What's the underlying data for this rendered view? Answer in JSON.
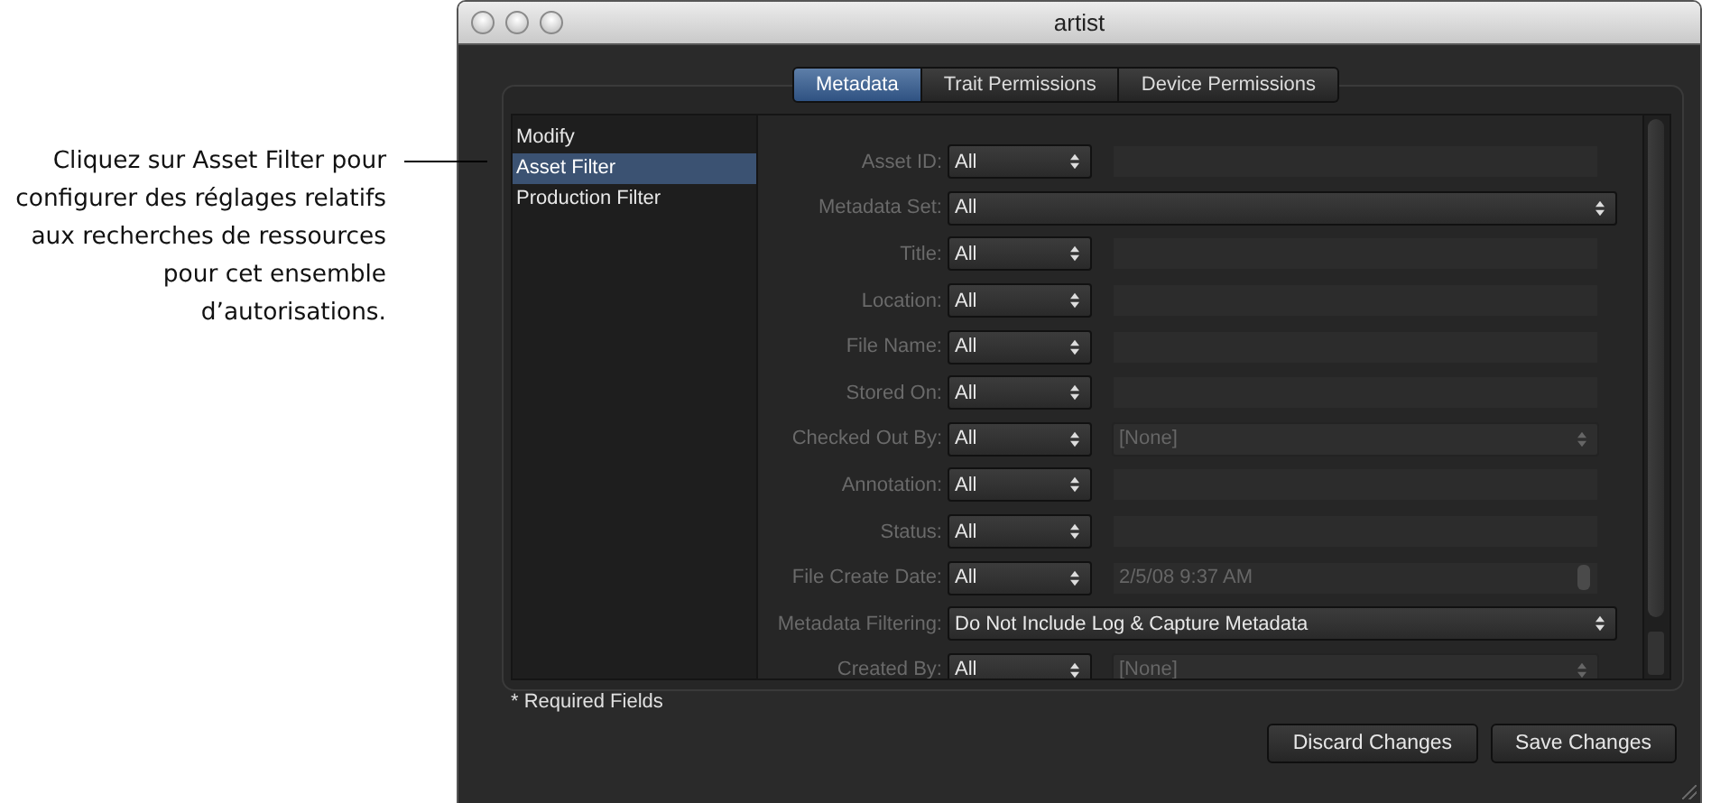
{
  "caption": "Cliquez sur Asset Filter pour configurer des réglages relatifs aux recherches de ressources pour cet ensemble d’autorisations.",
  "window": {
    "title": "artist"
  },
  "tabs": [
    {
      "label": "Metadata",
      "selected": true
    },
    {
      "label": "Trait Permissions",
      "selected": false
    },
    {
      "label": "Device Permissions",
      "selected": false
    }
  ],
  "sidebar": {
    "items": [
      {
        "label": "Modify",
        "selected": false
      },
      {
        "label": "Asset Filter",
        "selected": true
      },
      {
        "label": "Production Filter",
        "selected": false
      }
    ]
  },
  "form": {
    "rows": [
      {
        "label": "Asset ID:",
        "kind": "popup_field",
        "popup": "All"
      },
      {
        "label": "Metadata Set:",
        "kind": "popup_wide",
        "popup": "All"
      },
      {
        "label": "Title:",
        "kind": "popup_field",
        "popup": "All"
      },
      {
        "label": "Location:",
        "kind": "popup_field",
        "popup": "All"
      },
      {
        "label": "File Name:",
        "kind": "popup_field",
        "popup": "All"
      },
      {
        "label": "Stored On:",
        "kind": "popup_field",
        "popup": "All"
      },
      {
        "label": "Checked Out By:",
        "kind": "popup_popup",
        "popup": "All",
        "second": "[None]"
      },
      {
        "label": "Annotation:",
        "kind": "popup_field",
        "popup": "All"
      },
      {
        "label": "Status:",
        "kind": "popup_field",
        "popup": "All"
      },
      {
        "label": "File Create Date:",
        "kind": "popup_date",
        "popup": "All",
        "second": "2/5/08 9:37 AM"
      },
      {
        "label": "Metadata Filtering:",
        "kind": "popup_wide",
        "popup": "Do Not Include Log & Capture Metadata"
      },
      {
        "label": "Created By:",
        "kind": "popup_popup",
        "popup": "All",
        "second": "[None]"
      }
    ]
  },
  "note": "* Required Fields",
  "buttons": [
    "Discard Changes",
    "Save Changes"
  ]
}
